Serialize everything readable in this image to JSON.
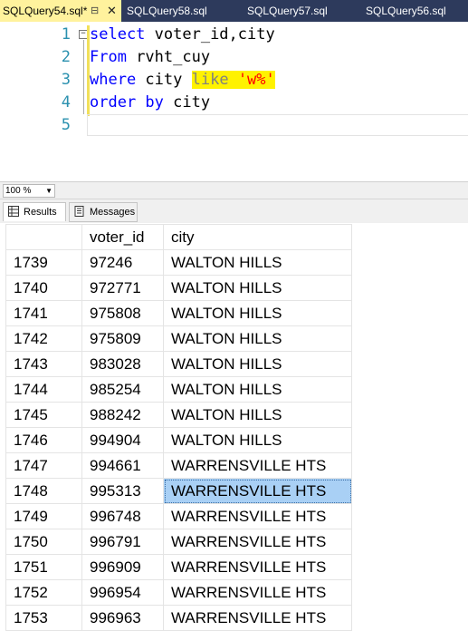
{
  "tabs": [
    {
      "label": "SQLQuery54.sql*",
      "active": true
    },
    {
      "label": "SQLQuery58.sql"
    },
    {
      "label": "SQLQuery57.sql"
    },
    {
      "label": "SQLQuery56.sql"
    }
  ],
  "editor": {
    "line_numbers": [
      "1",
      "2",
      "3",
      "4",
      "5"
    ],
    "line1": {
      "kw": "select",
      "rest": " voter_id,city"
    },
    "line2": {
      "kw": "From",
      "rest": " rvht_cuy"
    },
    "line3": {
      "kw": "where",
      "mid": " city ",
      "like": "like",
      "space": " ",
      "str": "'w%'"
    },
    "line4": {
      "kw": "order by",
      "rest": " city"
    },
    "colors": {
      "keyword": "#0000ff",
      "string": "#ff0000",
      "operator": "#808080",
      "highlight": "#fff200",
      "line_numbers": "#2b91af"
    }
  },
  "zoom": {
    "value": "100 %"
  },
  "result_tabs": {
    "results": "Results",
    "messages": "Messages"
  },
  "grid": {
    "columns": [
      "",
      "voter_id",
      "city"
    ],
    "rows": [
      [
        "1739",
        "97246",
        "WALTON HILLS"
      ],
      [
        "1740",
        "972771",
        "WALTON HILLS"
      ],
      [
        "1741",
        "975808",
        "WALTON HILLS"
      ],
      [
        "1742",
        "975809",
        "WALTON HILLS"
      ],
      [
        "1743",
        "983028",
        "WALTON HILLS"
      ],
      [
        "1744",
        "985254",
        "WALTON HILLS"
      ],
      [
        "1745",
        "988242",
        "WALTON HILLS"
      ],
      [
        "1746",
        "994904",
        "WALTON HILLS"
      ],
      [
        "1747",
        "994661",
        "WARRENSVILLE HTS"
      ],
      [
        "1748",
        "995313",
        "WARRENSVILLE HTS"
      ],
      [
        "1749",
        "996748",
        "WARRENSVILLE HTS"
      ],
      [
        "1750",
        "996791",
        "WARRENSVILLE HTS"
      ],
      [
        "1751",
        "996909",
        "WARRENSVILLE HTS"
      ],
      [
        "1752",
        "996954",
        "WARRENSVILLE HTS"
      ],
      [
        "1753",
        "996963",
        "WARRENSVILLE HTS"
      ]
    ],
    "selected_row": 9,
    "selection_color": "#a9d0f5"
  }
}
